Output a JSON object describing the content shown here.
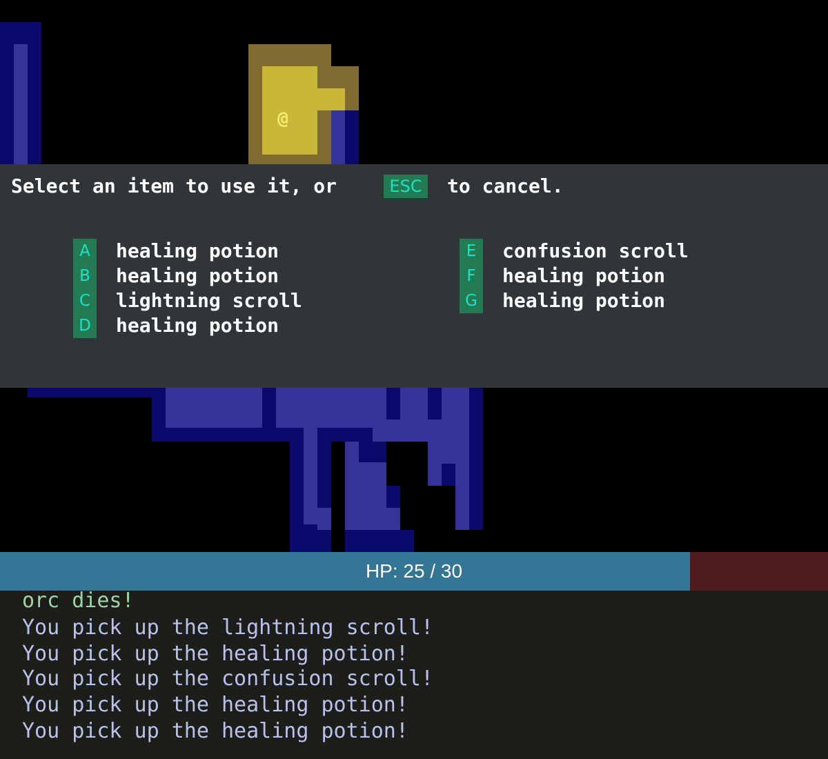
{
  "colors": {
    "wall_dark": "#0a0a6c",
    "floor_blue": "#33339a",
    "lit_dark": "#7f6a31",
    "lit_light": "#cbb737",
    "modal_bg": "#2f3538",
    "key_bg": "#237a53",
    "key_fg": "#17e3c6",
    "hp_fill": "#337594",
    "hp_empty": "#4e1c1c",
    "log_bg": "#1d1e1a",
    "log_death": "#9fd3a8",
    "log_pickup": "#b9c2ec"
  },
  "map": {
    "player_glyph": "@"
  },
  "menu": {
    "prompt_before": "Select an item to use it, or",
    "escape_key": "ESC",
    "prompt_after": "to cancel.",
    "items": [
      {
        "key": "A",
        "name": "healing potion"
      },
      {
        "key": "B",
        "name": "healing potion"
      },
      {
        "key": "C",
        "name": "lightning scroll"
      },
      {
        "key": "D",
        "name": "healing potion"
      },
      {
        "key": "E",
        "name": "confusion scroll"
      },
      {
        "key": "F",
        "name": "healing potion"
      },
      {
        "key": "G",
        "name": "healing potion"
      }
    ]
  },
  "hp": {
    "label": "HP: 25 / 30",
    "current": 25,
    "max": 30
  },
  "log": {
    "lines": [
      {
        "text": "orc dies!",
        "kind": "death"
      },
      {
        "text": "You pick up the lightning scroll!",
        "kind": "pickup"
      },
      {
        "text": "You pick up the healing potion!",
        "kind": "pickup"
      },
      {
        "text": "You pick up the confusion scroll!",
        "kind": "pickup"
      },
      {
        "text": "You pick up the healing potion!",
        "kind": "pickup"
      },
      {
        "text": "You pick up the healing potion!",
        "kind": "pickup"
      }
    ]
  }
}
